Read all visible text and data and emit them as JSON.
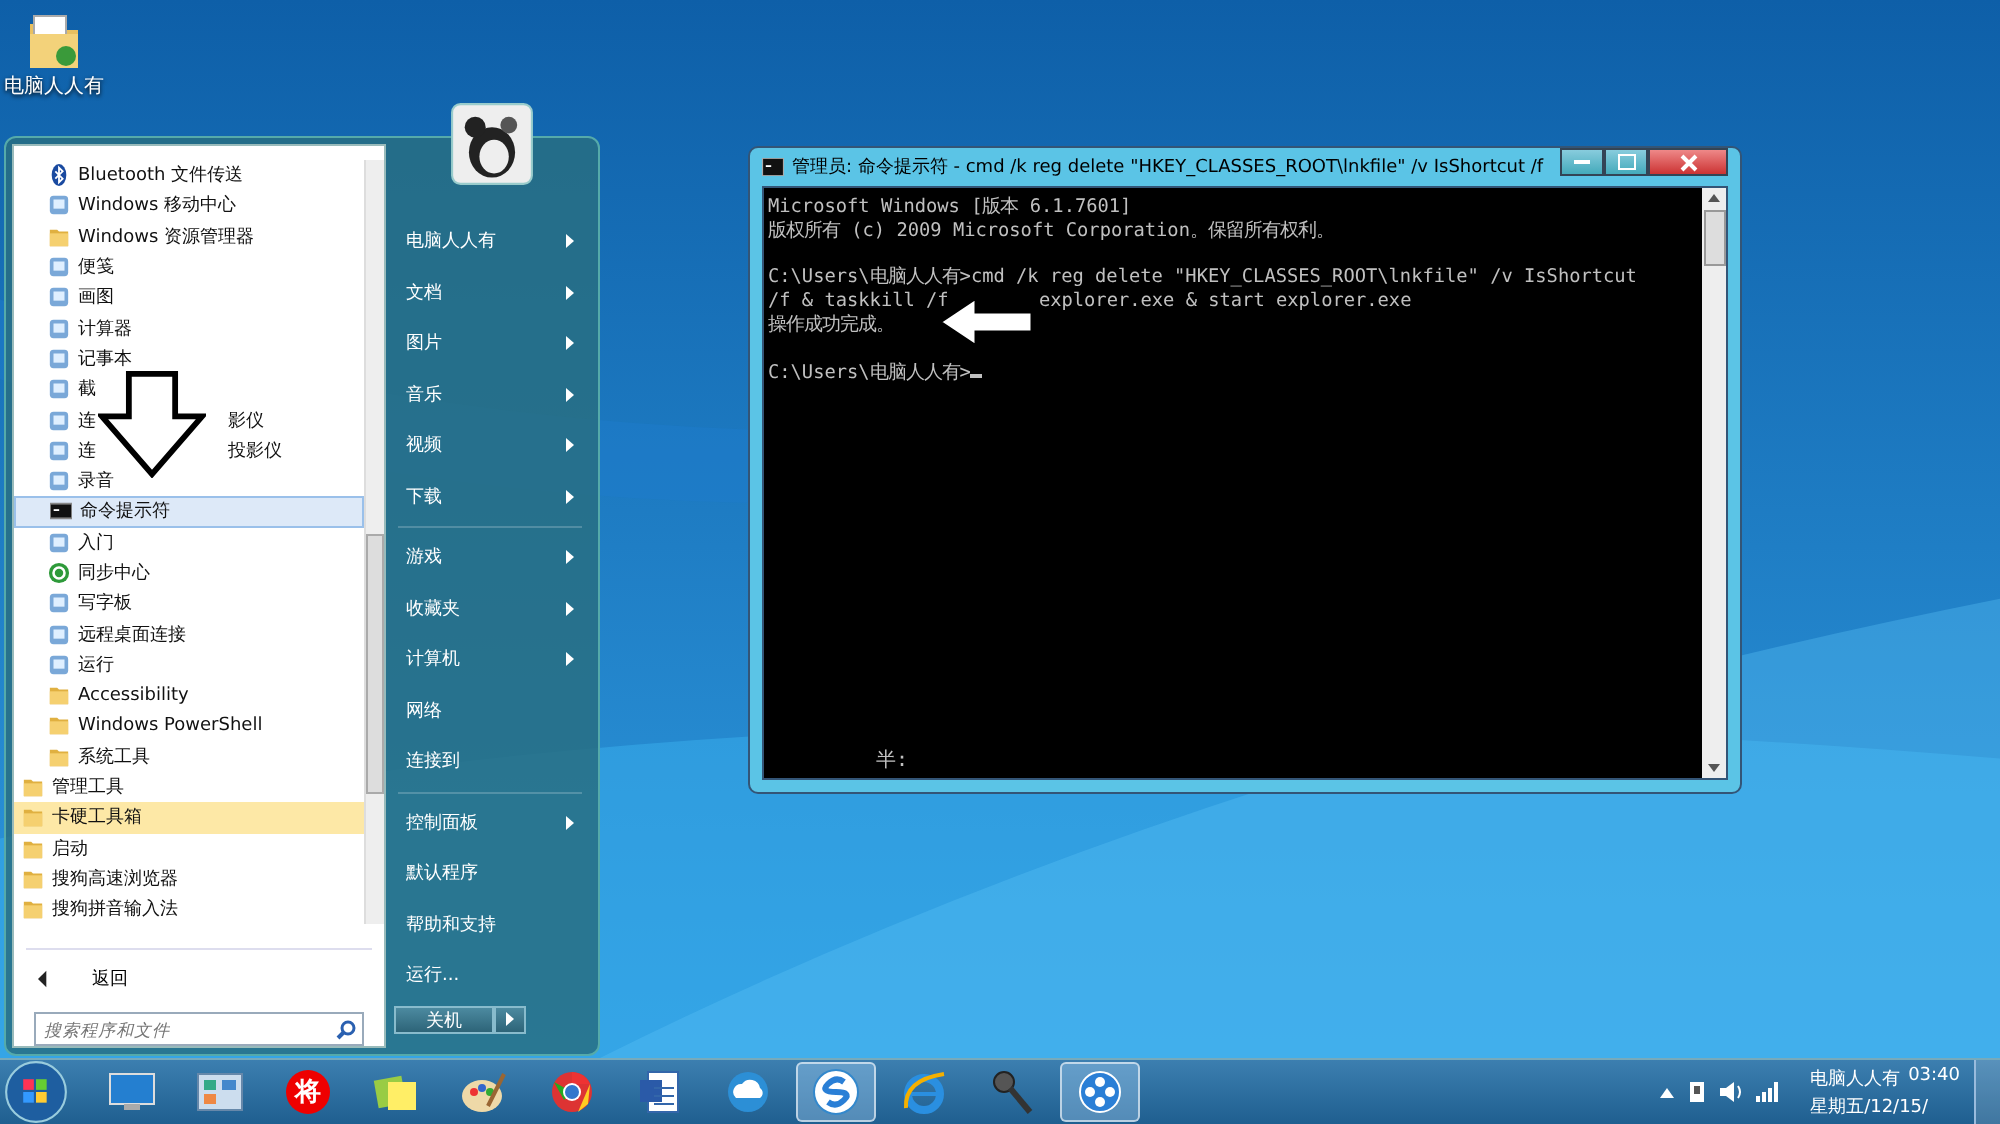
{
  "desktop_icons": [
    {
      "label": "电脑人人有"
    }
  ],
  "start_menu": {
    "programs": [
      {
        "label": "Bluetooth 文件传送",
        "kind": "bluetooth",
        "selected": false,
        "new": false
      },
      {
        "label": "Windows 移动中心",
        "kind": "app",
        "selected": false,
        "new": false
      },
      {
        "label": "Windows 资源管理器",
        "kind": "folder",
        "selected": false,
        "new": false
      },
      {
        "label": "便笺",
        "kind": "app",
        "selected": false,
        "new": false
      },
      {
        "label": "画图",
        "kind": "app",
        "selected": false,
        "new": false
      },
      {
        "label": "计算器",
        "kind": "app",
        "selected": false,
        "new": false
      },
      {
        "label": "记事本",
        "kind": "app",
        "selected": false,
        "new": false
      },
      {
        "label": "截",
        "kind": "app",
        "selected": false,
        "new": false
      },
      {
        "label": "连",
        "tail": "影仪",
        "kind": "app",
        "selected": false,
        "new": false
      },
      {
        "label": "连",
        "tail": "投影仪",
        "kind": "app",
        "selected": false,
        "new": false
      },
      {
        "label": "录音",
        "kind": "app",
        "selected": false,
        "new": false
      },
      {
        "label": "命令提示符",
        "kind": "console",
        "selected": true,
        "new": false
      },
      {
        "label": "入门",
        "kind": "app",
        "selected": false,
        "new": false
      },
      {
        "label": "同步中心",
        "kind": "sync",
        "selected": false,
        "new": false
      },
      {
        "label": "写字板",
        "kind": "app",
        "selected": false,
        "new": false
      },
      {
        "label": "远程桌面连接",
        "kind": "app",
        "selected": false,
        "new": false
      },
      {
        "label": "运行",
        "kind": "app",
        "selected": false,
        "new": false
      },
      {
        "label": "Accessibility",
        "kind": "folder",
        "selected": false,
        "new": false
      },
      {
        "label": "Windows PowerShell",
        "kind": "folder",
        "selected": false,
        "new": false
      },
      {
        "label": "系统工具",
        "kind": "folder",
        "selected": false,
        "new": false
      }
    ],
    "folders": [
      {
        "label": "管理工具",
        "selected": false,
        "new": false
      },
      {
        "label": "卡硬工具箱",
        "selected": false,
        "new": true
      },
      {
        "label": "启动",
        "selected": false,
        "new": false
      },
      {
        "label": "搜狗高速浏览器",
        "selected": false,
        "new": false
      },
      {
        "label": "搜狗拼音输入法",
        "selected": false,
        "new": false
      }
    ],
    "back": "返回",
    "search": {
      "placeholder": "搜索程序和文件"
    },
    "places": [
      [
        {
          "label": "电脑人人有",
          "submenu": true
        },
        {
          "label": "文档",
          "submenu": true
        },
        {
          "label": "图片",
          "submenu": true
        },
        {
          "label": "音乐",
          "submenu": true
        },
        {
          "label": "视频",
          "submenu": true
        },
        {
          "label": "下载",
          "submenu": true
        }
      ],
      [
        {
          "label": "游戏",
          "submenu": true
        },
        {
          "label": "收藏夹",
          "submenu": true
        },
        {
          "label": "计算机",
          "submenu": true
        },
        {
          "label": "网络",
          "submenu": false
        },
        {
          "label": "连接到",
          "submenu": false
        }
      ],
      [
        {
          "label": "控制面板",
          "submenu": true
        },
        {
          "label": "默认程序",
          "submenu": false
        },
        {
          "label": "帮助和支持",
          "submenu": false
        },
        {
          "label": "运行...",
          "submenu": false
        }
      ]
    ],
    "shutdown": "关机"
  },
  "console_window": {
    "title": "管理员: 命令提示符 - cmd  /k reg delete \"HKEY_CLASSES_ROOT\\lnkfile\" /v IsShortcut /f",
    "blocks": [
      [
        "Microsoft Windows [版本 6.1.7601]",
        "版权所有 (c) 2009 Microsoft Corporation。保留所有权利。"
      ],
      [
        "C:\\Users\\电脑人人有>cmd /k reg delete \"HKEY_CLASSES_ROOT\\lnkfile\" /v IsShortcut",
        "/f & taskkill /f        explorer.exe & start explorer.exe",
        "操作成功完成。"
      ],
      [
        "C:\\Users\\电脑人人有>"
      ]
    ],
    "ime_status": "半:"
  },
  "taskbar": {
    "items": [
      {
        "kind": "monitor",
        "active": false
      },
      {
        "kind": "panel",
        "active": false
      },
      {
        "kind": "badge",
        "text": "将",
        "active": false
      },
      {
        "kind": "notes",
        "active": false
      },
      {
        "kind": "palette",
        "active": false
      },
      {
        "kind": "browser",
        "active": false
      },
      {
        "kind": "document",
        "active": false
      },
      {
        "kind": "cloud",
        "active": false
      },
      {
        "kind": "sogou",
        "active": true
      },
      {
        "kind": "ie",
        "active": false
      },
      {
        "kind": "microphone",
        "active": false
      },
      {
        "kind": "film",
        "active": true
      }
    ],
    "clock": {
      "user": "电脑人人有",
      "time": "03:40",
      "date": "星期五/12/15/"
    }
  }
}
